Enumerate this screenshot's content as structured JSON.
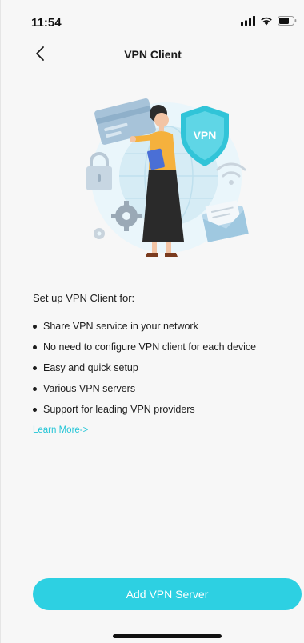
{
  "status_bar": {
    "time": "11:54",
    "signal_icon": "cellular-signal-icon",
    "wifi_icon": "wifi-icon",
    "battery_icon": "battery-icon"
  },
  "nav": {
    "back_icon": "chevron-left-icon",
    "title": "VPN Client"
  },
  "illustration": {
    "shield_text": "VPN",
    "icon": "vpn-illustration"
  },
  "content": {
    "intro": "Set up VPN Client for:",
    "features": [
      "Share VPN service in your network",
      "No need to configure VPN client for each device",
      "Easy and quick setup",
      "Various VPN servers",
      "Support for leading VPN providers"
    ],
    "learn_more": "Learn More->"
  },
  "actions": {
    "add_server": "Add VPN Server"
  },
  "colors": {
    "accent": "#2dd0e2",
    "link": "#22c5d6",
    "background": "#f7f7f7"
  }
}
